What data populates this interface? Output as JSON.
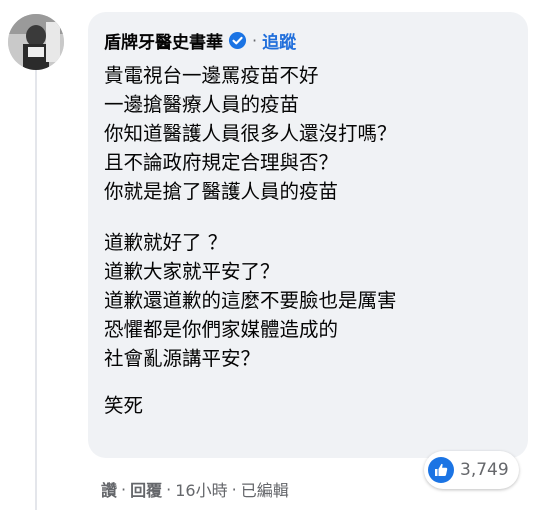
{
  "comment": {
    "author": "盾牌牙醫史書華",
    "separator": "·",
    "follow_label": "追蹤",
    "lines_block1": [
      "貴電視台一邊罵疫苗不好",
      "一邊搶醫療人員的疫苗",
      "你知道醫護人員很多人還沒打嗎？",
      "且不論政府規定合理與否？",
      "你就是搶了醫護人員的疫苗"
    ],
    "lines_block2": [
      "道歉就好了 ？",
      "道歉大家就平安了？",
      "道歉還道歉的這麼不要臉也是厲害",
      "恐懼都是你們家媒體造成的",
      "社會亂源講平安？"
    ],
    "lines_block3": [
      "笑死"
    ]
  },
  "actions": {
    "like_label": "讚",
    "reply_label": "回覆",
    "time": "16小時",
    "edited": "已編輯",
    "dot": "·"
  },
  "reactions": {
    "icon": "thumbs-up-icon",
    "count": "3,749",
    "color": "#1b74e4"
  },
  "colors": {
    "bubble": "#f0f2f5",
    "link": "#216fdb",
    "secondary_text": "#65676b"
  }
}
